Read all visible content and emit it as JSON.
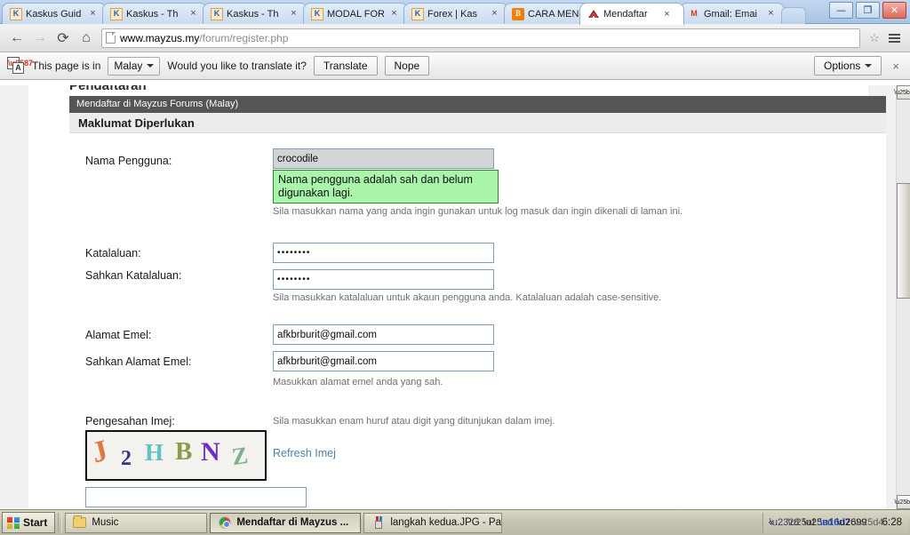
{
  "browser": {
    "tabs": [
      {
        "label": "Kaskus Guid",
        "favicon": "kaskus-icon",
        "active": false
      },
      {
        "label": "Kaskus - Th",
        "favicon": "kaskus-icon",
        "active": false
      },
      {
        "label": "Kaskus - Th",
        "favicon": "kaskus-icon",
        "active": false
      },
      {
        "label": "MODAL FOR",
        "favicon": "kaskus-icon",
        "active": false
      },
      {
        "label": "Forex | Kas",
        "favicon": "kaskus-icon",
        "active": false
      },
      {
        "label": "CARA MENI",
        "favicon": "blogger-icon",
        "active": false
      },
      {
        "label": "Mendaftar",
        "favicon": "mayzus-icon",
        "active": true
      },
      {
        "label": "Gmail: Emai",
        "favicon": "gmail-icon",
        "active": false
      }
    ],
    "tab_close_label": "×",
    "window_controls": {
      "minimize": "—",
      "maximize": "❐",
      "close": "✕"
    },
    "toolbar": {
      "back": "←",
      "forward": "→",
      "reload": "⟳",
      "home": "⌂",
      "url_main": "www.mayzus.my",
      "url_path": "/forum/register.php",
      "bookmark": "☆"
    },
    "infobar": {
      "message": "This page is in",
      "language": "Malay",
      "question": "Would you like to translate it?",
      "translate_button": "Translate",
      "nope_button": "Nope",
      "options_button": "Options",
      "close": "×"
    }
  },
  "page": {
    "heading": "Pendaftaran",
    "form_header": "Mendaftar di Mayzus Forums (Malay)",
    "section_title": "Maklumat Diperlukan",
    "fields": {
      "username": {
        "label": "Nama Pengguna:",
        "value": "crocodile",
        "validation": "Nama pengguna adalah sah dan belum digunakan lagi.",
        "hint": "Sila masukkan nama yang anda ingin gunakan untuk log masuk dan ingin dikenali di laman ini."
      },
      "password": {
        "label": "Katalaluan:",
        "value": "••••••••"
      },
      "password_confirm": {
        "label": "Sahkan Katalaluan:",
        "value": "••••••••",
        "hint": "Sila masukkan katalaluan untuk akaun pengguna anda. Katalaluan adalah case-sensitive."
      },
      "email": {
        "label": "Alamat Emel:",
        "value": "afkbrburit@gmail.com"
      },
      "email_confirm": {
        "label": "Sahkan Alamat Emel:",
        "value": "afkbrburit@gmail.com",
        "hint": "Masukkan alamat emel anda yang sah."
      },
      "captcha": {
        "label": "Pengesahan Imej:",
        "hint": "Sila masukkan enam huruf atau digit yang ditunjukan dalam imej.",
        "refresh_link": "Refresh Imej",
        "input_value": "",
        "characters": [
          {
            "char": "J",
            "color": "#e07a3c"
          },
          {
            "char": "2",
            "color": "#2d3a8c"
          },
          {
            "char": "H",
            "color": "#5fc4bc"
          },
          {
            "char": "B",
            "color": "#8c9a4a"
          },
          {
            "char": "N",
            "color": "#6a2fc4"
          },
          {
            "char": "Z",
            "color": "#7fb08a"
          }
        ]
      }
    }
  },
  "taskbar": {
    "start_label": "Start",
    "items": [
      {
        "label": "Music",
        "icon": "folder-icon",
        "active": false
      },
      {
        "label": "Mendaftar di Mayzus ...",
        "icon": "chrome-icon",
        "active": true
      },
      {
        "label": "langkah kedua.JPG - Paint",
        "icon": "paint-icon",
        "active": false
      }
    ],
    "tray": {
      "expand": "«",
      "icons": [
        "network-icon",
        "usb-icon",
        "monitor-icon",
        "bluetooth-icon",
        "device-icon",
        "volume-icon"
      ],
      "clock": "6:28"
    }
  },
  "colors": {
    "form_header_bg": "#555555",
    "validation_bg": "#a9f5a9",
    "link": "#4f81a8",
    "field_border": "#7f9db9"
  }
}
